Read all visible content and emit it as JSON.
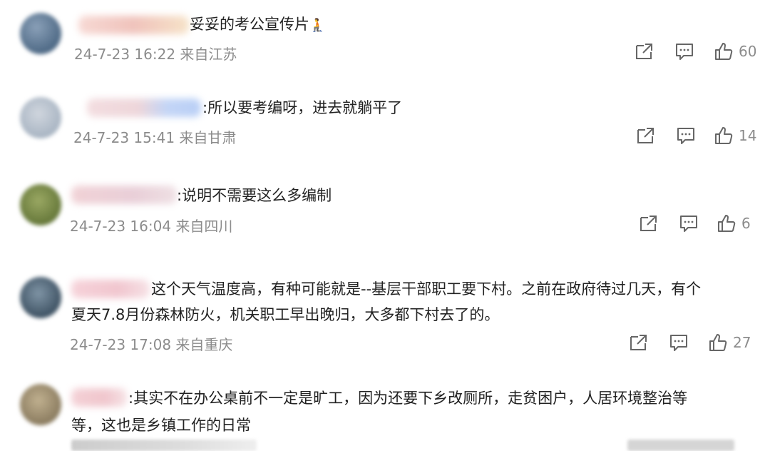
{
  "comments": [
    {
      "text": "妥妥的考公宣传片",
      "emoji": "🧎",
      "time": "24-7-23 16:22",
      "location": "来自江苏",
      "likes": "60",
      "avatar_color": "#6e8aa8",
      "name_blur_color": "#f0c7c0"
    },
    {
      "text": ":所以要考编呀，进去就躺平了",
      "time": "24-7-23 15:41",
      "location": "来自甘肃",
      "likes": "14",
      "avatar_color": "#b7c2cf",
      "name_blur_color": "#c9d9f5"
    },
    {
      "text": ":说明不需要这么多编制",
      "time": "24-7-23 16:04",
      "location": "来自四川",
      "likes": "6",
      "avatar_color": "#7d8f4a",
      "name_blur_color": "#f1d2d6"
    },
    {
      "text": "这个天气温度高，有种可能就是--基层干部职工要下村。之前在政府待过几天，有个",
      "text2": "夏天7.8月份森林防火，机关职工早出晚归，大多都下村去了的。",
      "time": "24-7-23 17:08",
      "location": "来自重庆",
      "likes": "27",
      "avatar_color": "#5b6f80",
      "name_blur_color": "#f4cbd3"
    },
    {
      "text": ":其实不在办公桌前不一定是旷工，因为还要下乡改厕所，走贫困户，人居环境整治等",
      "text2": "等，这也是乡镇工作的日常",
      "avatar_color": "#a49579",
      "name_blur_color": "#f3c9cf"
    }
  ],
  "icons": {
    "share": "share-icon",
    "comment": "comment-icon",
    "like": "thumbs-up-icon"
  }
}
